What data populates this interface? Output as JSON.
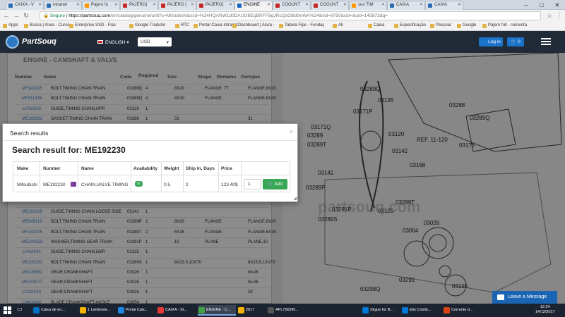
{
  "browser": {
    "tabs": [
      {
        "label": "CAIXA - V",
        "color": "#2b6cb0"
      },
      {
        "label": "intranet",
        "color": "#2b6cb0"
      },
      {
        "label": "Pajero fu",
        "color": "#ff9800"
      },
      {
        "label": "PAJERO(",
        "color": "#c62828"
      },
      {
        "label": "PAJERO (",
        "color": "#c62828"
      },
      {
        "label": "PAJERO(",
        "color": "#c62828"
      },
      {
        "label": "ENGINE",
        "color": "#1565c0"
      },
      {
        "label": "COOUNT",
        "color": "#c62828"
      },
      {
        "label": "COOUNT",
        "color": "#c62828"
      },
      {
        "label": "sun TIM",
        "color": "#ff9800"
      },
      {
        "label": "CAIXA",
        "color": "#2b6cb0"
      },
      {
        "label": "CAIXA",
        "color": "#2b6cb0"
      }
    ],
    "active_tab_index": 6,
    "address": {
      "secure_label": "Seguro",
      "host": "https://partsouq.com",
      "path": "/en/catalog/genuine/unit?c=Mitsubishi&ssd=%24HQARW1d0DAUGBEgBRFFBgJRcQcGBd0wWA%24&vid=9750&cid=&uid=145873&q="
    },
    "bookmarks": [
      "Apps",
      "Busca | Alura - Curso",
      "Enterprise SSD - Flas",
      "Google Tradutor",
      "RTC",
      "Portal Caixa Intranet",
      "Dashboard | Alura -",
      "Tabela Fipe - Fundaç",
      "Ali",
      "Caixa",
      "Especificação",
      "Pessoal",
      "Google",
      "Pajero full - comenta"
    ]
  },
  "site": {
    "logo_text": "PartSouq",
    "language": "ENGLISH",
    "currency": "USD",
    "login_label": "Log in",
    "cart_count": "0"
  },
  "catalog": {
    "title": "ENGINE - CAMSHAFT & VALVE",
    "columns": [
      "Number",
      "Name",
      "Code",
      "Required",
      "Size",
      "Shape",
      "Remarks",
      "Partspec"
    ],
    "rows_top": [
      {
        "number": "MF140225",
        "name": "BOLT,TIMING CHAIN TRAIN",
        "code": "03289Q",
        "req": "4",
        "size": "8X20",
        "shape": "FLANGE",
        "remarks": "7T",
        "spec": "FLANGE,8X20"
      },
      {
        "number": "MF911336",
        "name": "BOLT,TIMING CHAIN TRAIN",
        "code": "03289Q",
        "req": "4",
        "size": "8X20",
        "shape": "FLANGE",
        "remarks": "",
        "spec": "FLANGE,8X20"
      },
      {
        "number": "1140A026",
        "name": "GUIDE,TIMING CHAIN,UPR",
        "code": "03126",
        "req": "1",
        "size": "",
        "shape": "",
        "remarks": "",
        "spec": ""
      },
      {
        "number": "ME193622",
        "name": "GASKET,TIMING CHAIN TRAIN",
        "code": "03288",
        "req": "1",
        "size": "31",
        "shape": "",
        "remarks": "",
        "spec": "31"
      }
    ],
    "rows_bottom": [
      {
        "number": "ME191029",
        "name": "GUIDE,TIMING CHAIN LOOSE SIDE",
        "code": "03141",
        "req": "1",
        "size": "",
        "shape": "",
        "remarks": "",
        "spec": ""
      },
      {
        "number": "ME949116",
        "name": "BOLT,TIMING CHAIN TRAIN",
        "code": "03289P",
        "req": "2",
        "size": "8X20",
        "shape": "FLANGE",
        "remarks": "",
        "spec": "FLANGE,8X20"
      },
      {
        "number": "MF140206",
        "name": "BOLT,TIMING CHAIN TRAIN",
        "code": "03289T",
        "req": "2",
        "size": "6X16",
        "shape": "FLANGE",
        "remarks": "",
        "spec": "FLANGE,6X16"
      },
      {
        "number": "ME200253",
        "name": "WASHER,TIMING GEAR TRAIN",
        "code": "03291P",
        "req": "1",
        "size": "10",
        "shape": "PLANE",
        "remarks": "",
        "spec": "PLANE,10"
      },
      {
        "number": "1140A041",
        "name": "GUIDE,TIMING CHAIN,LWR",
        "code": "03125",
        "req": "1",
        "size": "",
        "shape": "",
        "remarks": "",
        "spec": ""
      },
      {
        "number": "ME200252",
        "name": "BOLT,TIMING CHAIN TRAIN",
        "code": "03289S",
        "req": "1",
        "size": "8X23.5,10X70",
        "shape": "",
        "remarks": "",
        "spec": "8X23.5,10X70"
      },
      {
        "number": "ME229692",
        "name": "GEAR,CRANKSHAFT",
        "code": "03026",
        "req": "1",
        "size": "",
        "shape": "",
        "remarks": "",
        "spec": "N=28"
      },
      {
        "number": "ME203077",
        "name": "GEAR,CRANKSHAFT",
        "code": "03026",
        "req": "1",
        "size": "",
        "shape": "",
        "remarks": "",
        "spec": "N=28"
      },
      {
        "number": "1130A240",
        "name": "GEAR,CRANKSHAFT",
        "code": "03026",
        "req": "1",
        "size": "",
        "shape": "",
        "remarks": "",
        "spec": "28"
      },
      {
        "number": "1040A002",
        "name": "BLADE,CRANKSHAFT ANGLE",
        "code": "03054",
        "req": "1",
        "size": "",
        "shape": "",
        "remarks": "",
        "spec": ""
      }
    ]
  },
  "diagram": {
    "labels": [
      "03289Q",
      "03126",
      "03171P",
      "03171Q",
      "03289",
      "03289T",
      "03120",
      "03142",
      "03168",
      "03141",
      "03288",
      "03289Q",
      "03176",
      "REF. 11-120",
      "03289P",
      "03291P",
      "03125",
      "03289T",
      "03289S",
      "03064",
      "03026",
      "03291",
      "03298Q",
      "03155",
      "partsouq.com"
    ]
  },
  "modal": {
    "title": "Search results",
    "close_label": "×",
    "heading": "Search result for: ME192230",
    "columns": [
      "Make",
      "Number",
      "Name",
      "Availability",
      "Weight",
      "Ship In, Days",
      "Price"
    ],
    "row": {
      "make": "Mitsubishi",
      "number": "ME192230",
      "name": "CHAIN,VALVE TIMING",
      "availability": "m",
      "weight": "0.5",
      "ship_days": "2",
      "price": "123.40$",
      "quantity": "1",
      "add_label": "Add"
    }
  },
  "chat": {
    "label": "Leave a Message"
  },
  "taskbar": {
    "items": [
      {
        "label": "Caixa de en...",
        "color": "#0072c6"
      },
      {
        "label": "1 Lembrete...",
        "color": "#f4b400"
      },
      {
        "label": "Portal Caix...",
        "color": "#1e88e5"
      },
      {
        "label": "CAIXA - SI...",
        "color": "#e53935"
      },
      {
        "label": "ENGINE - C...",
        "color": "#43a047"
      },
      {
        "label": "2017",
        "color": "#f4b400"
      },
      {
        "label": "APL7562W...",
        "color": "#555555"
      },
      {
        "label": "Skype for B...",
        "color": "#0078d7"
      },
      {
        "label": "Elis Cristin...",
        "color": "#0078d7"
      },
      {
        "label": "Corrente d...",
        "color": "#d84315"
      }
    ],
    "active_index": 4,
    "time": "12:24",
    "date": "14/12/2017"
  }
}
